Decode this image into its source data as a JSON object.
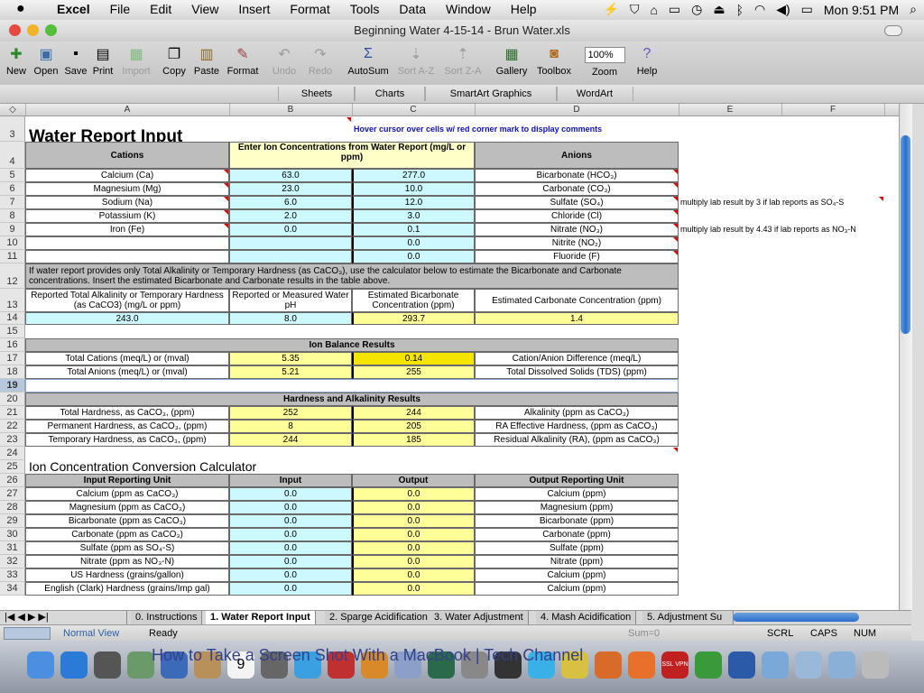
{
  "menubar": {
    "apple": "",
    "app": "Excel",
    "menus": [
      "File",
      "Edit",
      "View",
      "Insert",
      "Format",
      "Tools",
      "Data",
      "Window",
      "Help"
    ],
    "clock": "Mon 9:51 PM"
  },
  "window": {
    "title": "Beginning Water 4-15-14 - Brun Water.xls"
  },
  "toolbar": {
    "new": "New",
    "open": "Open",
    "save": "Save",
    "print": "Print",
    "import": "Import",
    "copy": "Copy",
    "paste": "Paste",
    "format": "Format",
    "undo": "Undo",
    "redo": "Redo",
    "autosum": "AutoSum",
    "sort_az": "Sort A-Z",
    "sort_za": "Sort Z-A",
    "gallery": "Gallery",
    "toolbox": "Toolbox",
    "zoom_value": "100%",
    "zoom": "Zoom",
    "help": "Help"
  },
  "ribbon": {
    "sheets": "Sheets",
    "charts": "Charts",
    "smartart": "SmartArt Graphics",
    "wordart": "WordArt"
  },
  "columns": [
    "A",
    "B",
    "C",
    "D",
    "E",
    "F"
  ],
  "rows": [
    "3",
    "4",
    "5",
    "6",
    "7",
    "8",
    "9",
    "10",
    "11",
    "12",
    "13",
    "14",
    "15",
    "16",
    "17",
    "18",
    "19",
    "20",
    "21",
    "22",
    "23",
    "24",
    "25",
    "26",
    "27",
    "28",
    "29",
    "30",
    "31",
    "32",
    "33",
    "34"
  ],
  "sheet": {
    "title": "Water Report Input",
    "hover_note": "Hover cursor over cells w/ red corner mark to display comments",
    "cations_header": "Cations",
    "enter_header": "Enter Ion Concentrations from Water Report    (mg/L or ppm)",
    "anions_header": "Anions",
    "ion_rows": [
      {
        "cation": "Calcium (Ca)",
        "b": "63.0",
        "c": "277.0",
        "anion": "Bicarbonate (HCO₃)"
      },
      {
        "cation": "Magnesium (Mg)",
        "b": "23.0",
        "c": "10.0",
        "anion": "Carbonate (CO₃)"
      },
      {
        "cation": "Sodium (Na)",
        "b": "6.0",
        "c": "12.0",
        "anion": "Sulfate (SO₄)"
      },
      {
        "cation": "Potassium (K)",
        "b": "2.0",
        "c": "3.0",
        "anion": "Chloride (Cl)"
      },
      {
        "cation": "Iron (Fe)",
        "b": "0.0",
        "c": "0.1",
        "anion": "Nitrate (NO₃)"
      },
      {
        "cation": "",
        "b": "",
        "c": "0.0",
        "anion": "Nitrite (NO₂)"
      },
      {
        "cation": "",
        "b": "",
        "c": "0.0",
        "anion": "Fluoride (F)"
      }
    ],
    "note_sulfate": "multiply lab result by 3 if lab reports as SO₄-S",
    "note_nitrate": "multiply lab result by 4.43 if lab reports as NO₃-N",
    "alk_note": "If water report provides only Total Alkalinity or Temporary Hardness (as CaCO₃), use the calculator below to estimate the Bicarbonate and Carbonate concentrations.  Insert the estimated Bicarbonate and Carbonate results in the table above.",
    "alk_headers": [
      "Reported Total Alkalinity or Temporary Hardness (as CaCO3) (mg/L or ppm)",
      "Reported or Measured Water pH",
      "Estimated Bicarbonate Concentration (ppm)",
      "Estimated Carbonate               Concentration (ppm)"
    ],
    "alk_values": [
      "243.0",
      "8.0",
      "293.7",
      "1.4"
    ],
    "ion_balance_header": "Ion Balance Results",
    "ion_balance": [
      {
        "a": "Total Cations (meq/L) or (mval)",
        "b": "5.35",
        "c": "0.14",
        "d": "Cation/Anion Difference (meq/L)"
      },
      {
        "a": "Total Anions (meq/L) or (mval)",
        "b": "5.21",
        "c": "255",
        "d": "Total Dissolved Solids (TDS) (ppm)"
      }
    ],
    "hardness_header": "Hardness and Alkalinity Results",
    "hardness": [
      {
        "a": "Total Hardness, as CaCO₃, (ppm)",
        "b": "252",
        "c": "244",
        "d": "Alkalinity (ppm as CaCO₃)"
      },
      {
        "a": "Permanent Hardness, as CaCO₃, (ppm)",
        "b": "8",
        "c": "205",
        "d": "RA Effective Hardness, (ppm as CaCO₃)"
      },
      {
        "a": "Temporary Hardness, as CaCO₃, (ppm)",
        "b": "244",
        "c": "185",
        "d": "Residual Alkalinity (RA), (ppm as CaCO₃)"
      }
    ],
    "conv_title": "Ion Concentration Conversion Calculator",
    "conv_headers": [
      "Input Reporting Unit",
      "Input",
      "Output",
      "Output Reporting Unit"
    ],
    "conv_rows": [
      {
        "a": "Calcium (ppm as CaCO₃)",
        "b": "0.0",
        "c": "0.0",
        "d": "Calcium (ppm)"
      },
      {
        "a": "Magnesium (ppm as CaCO₃)",
        "b": "0.0",
        "c": "0.0",
        "d": "Magnesium (ppm)"
      },
      {
        "a": "Bicarbonate (ppm as CaCO₃)",
        "b": "0.0",
        "c": "0.0",
        "d": "Bicarbonate (ppm)"
      },
      {
        "a": "Carbonate (ppm as CaCO₃)",
        "b": "0.0",
        "c": "0.0",
        "d": "Carbonate (ppm)"
      },
      {
        "a": "Sulfate (ppm as SO₄-S)",
        "b": "0.0",
        "c": "0.0",
        "d": "Sulfate (ppm)"
      },
      {
        "a": "Nitrate (ppm as NO₃-N)",
        "b": "0.0",
        "c": "0.0",
        "d": "Nitrate (ppm)"
      },
      {
        "a": "US Hardness (grains/gallon)",
        "b": "0.0",
        "c": "0.0",
        "d": "Calcium (ppm)"
      },
      {
        "a": "English (Clark) Hardness (grains/Imp gal)",
        "b": "0.0",
        "c": "0.0",
        "d": "Calcium (ppm)"
      }
    ]
  },
  "sheet_tabs": [
    "0. Instructions",
    "1. Water Report Input",
    "2. Sparge Acidification",
    "3. Water Adjustment",
    "4. Mash Acidification",
    "5. Adjustment Su"
  ],
  "status": {
    "view": "Normal View",
    "ready": "Ready",
    "sum": "Sum=0",
    "scrl": "SCRL",
    "caps": "CAPS",
    "num": "NUM"
  },
  "dock": {
    "tab_label": "How to Take a Screen Shot With a MacBook | Tech Channel",
    "calendar_day": "9",
    "vpn_label": "SSL VPN"
  },
  "colors": {
    "cyan": "#ccf8ff",
    "yellow": "#ffff9a",
    "gold": "#f4e400",
    "gray": "#bdbdbd",
    "accent": "#2b6fcb"
  }
}
